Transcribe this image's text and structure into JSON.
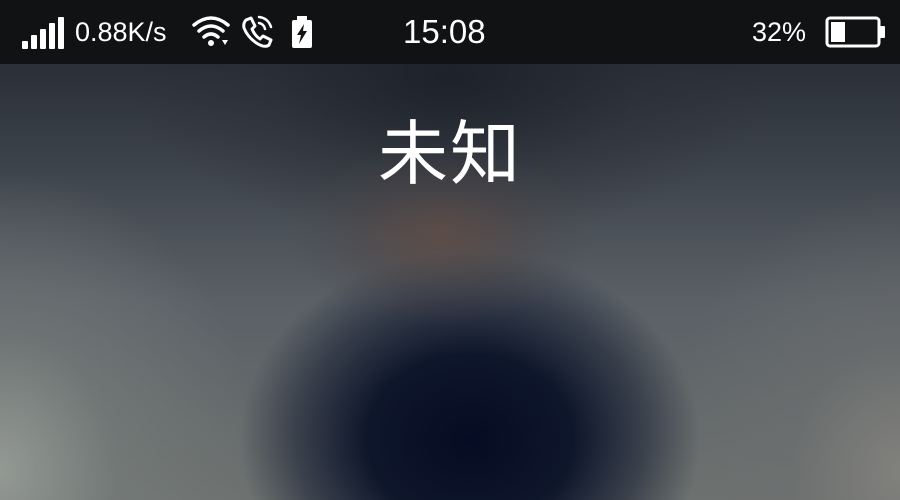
{
  "status_bar": {
    "network_speed": "0.88K/s",
    "time": "15:08",
    "battery_percent": "32%",
    "battery_level": 0.32,
    "icons": [
      "signal-icon",
      "wifi-icon",
      "phone-call-icon",
      "battery-charging-icon",
      "battery-icon"
    ]
  },
  "call": {
    "caller_name": "未知"
  },
  "colors": {
    "status_bar_bg": "#111213",
    "text": "#ffffff"
  }
}
